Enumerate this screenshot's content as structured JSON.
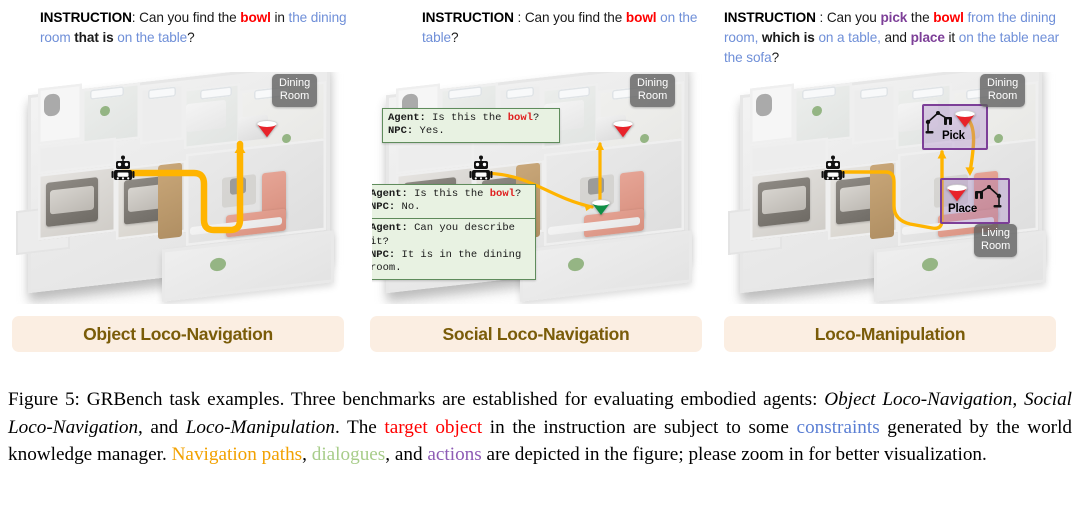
{
  "figure": {
    "caption_label": "Figure 5:",
    "caption_parts": {
      "p1": " GRBench task examples. Three benchmarks are established for evaluating embodied agents: ",
      "b1": "Object Loco-Navigation",
      "p2": ", ",
      "b2": "Social Loco-Navigation",
      "p3": ", and ",
      "b3": "Loco-Manipulation",
      "p4": ". The ",
      "c1": "target object",
      "p5": " in the instruction are subject to some ",
      "c2": "constraints",
      "p6": " generated by the world knowledge manager. ",
      "c3": "Navigation paths",
      "p7": ", ",
      "c4": "dialogues",
      "p8": ", and ",
      "c5": "actions",
      "p9": " are depicted in the figure; please zoom in for better visualization."
    },
    "colors": {
      "target_object": "#ff0000",
      "constraints": "#5b7fd4",
      "navigation_paths": "#f2a100",
      "dialogues": "#a8cd8a",
      "actions": "#8e5bb5",
      "panel_title_text": "#7a5c09",
      "panel_title_bg": "#fbeee2",
      "dialog_bg": "#e8f2e2",
      "dialog_border": "#5f8c5c",
      "action_border": "#7d3f98",
      "path_stroke": "#ffb400",
      "room_tag_bg": "#606060"
    }
  },
  "panels": [
    {
      "id": "object-loco-navigation",
      "title": "Object Loco-Navigation",
      "instruction": {
        "label": "INSTRUCTION",
        "sep": ": ",
        "seg1": "Can you find the ",
        "target": "bowl",
        "seg2": " in ",
        "constraint1": "the dining room",
        "seg3": " that is ",
        "constraint2": "on the table",
        "seg4": "?"
      },
      "room_tags": [
        {
          "name": "dining-room-tag",
          "text": "Dining\nRoom"
        }
      ],
      "markers": [
        {
          "name": "target-bowl-marker",
          "color": "#e8232a"
        }
      ],
      "dialogs": [],
      "actions": []
    },
    {
      "id": "social-loco-navigation",
      "title": "Social Loco-Navigation",
      "instruction": {
        "label": "INSTRUCTION",
        "sep": " : ",
        "seg1": "Can you find the ",
        "target": "bowl",
        "seg2": " ",
        "constraint1": "on the table",
        "seg3": "",
        "constraint2": "",
        "seg4": "?"
      },
      "room_tags": [
        {
          "name": "dining-room-tag",
          "text": "Dining\nRoom"
        }
      ],
      "markers": [
        {
          "name": "target-bowl-marker",
          "color": "#e8232a"
        },
        {
          "name": "wrong-bowl-marker",
          "color": "#0f8f45"
        }
      ],
      "dialogs": [
        {
          "name": "dialog-bubble-top",
          "lines": [
            {
              "speaker": "Agent:",
              "text_before": " Is this the ",
              "object": "bowl",
              "text_after": "?"
            },
            {
              "speaker": "NPC:",
              "text_before": " Yes.",
              "object": "",
              "text_after": ""
            }
          ]
        },
        {
          "name": "dialog-bubble-bottom-1",
          "lines": [
            {
              "speaker": "Agent:",
              "text_before": " Is this the ",
              "object": "bowl",
              "text_after": "?"
            },
            {
              "speaker": "NPC:",
              "text_before": " No.",
              "object": "",
              "text_after": ""
            }
          ]
        },
        {
          "name": "dialog-bubble-bottom-2",
          "lines": [
            {
              "speaker": "Agent:",
              "text_before": " Can you describe it?",
              "object": "",
              "text_after": ""
            },
            {
              "speaker": "NPC:",
              "text_before": " It is in the dining",
              "object": "",
              "text_after": ""
            },
            {
              "speaker": "",
              "text_before": "room.",
              "object": "",
              "text_after": ""
            }
          ]
        }
      ],
      "actions": []
    },
    {
      "id": "loco-manipulation",
      "title": "Loco-Manipulation",
      "instruction": {
        "label": "INSTRUCTION",
        "sep": " : ",
        "seg1": "Can you ",
        "action1": "pick",
        "seg2": " the ",
        "target": "bowl",
        "seg3": " ",
        "constraint1": "from the dining room,",
        "seg4": " which is ",
        "constraint2": "on a table,",
        "seg5": " and ",
        "action2": "place",
        "seg6": " it ",
        "constraint3": "on the table near the sofa",
        "seg7": "?"
      },
      "room_tags": [
        {
          "name": "dining-room-tag",
          "text": "Dining\nRoom"
        },
        {
          "name": "living-room-tag",
          "text": "Living\nRoom"
        }
      ],
      "markers": [],
      "actions": [
        {
          "name": "pick-action-box",
          "label": "Pick"
        },
        {
          "name": "place-action-box",
          "label": "Place"
        }
      ]
    }
  ]
}
